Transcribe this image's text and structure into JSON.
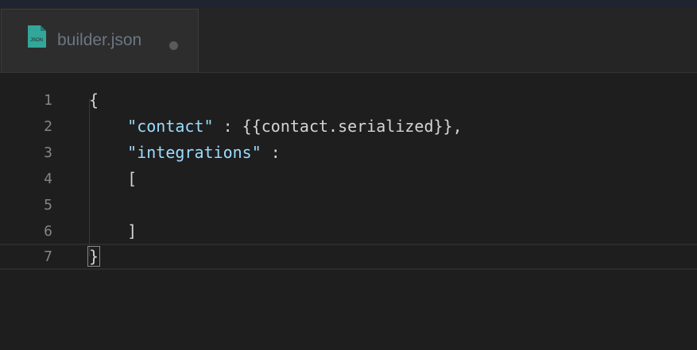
{
  "tab": {
    "title": "builder.json",
    "icon_name": "json-file-icon",
    "icon_text": "JSON",
    "icon_color": "#33a69a",
    "unsaved": true
  },
  "editor": {
    "lines": [
      {
        "num": "1",
        "indent": "",
        "key": "",
        "rest": "{"
      },
      {
        "num": "2",
        "indent": "    ",
        "key": "\"contact\"",
        "rest": " : {{contact.serialized}},"
      },
      {
        "num": "3",
        "indent": "    ",
        "key": "\"integrations\"",
        "rest": " :"
      },
      {
        "num": "4",
        "indent": "    ",
        "key": "",
        "rest": "["
      },
      {
        "num": "5",
        "indent": "",
        "key": "",
        "rest": ""
      },
      {
        "num": "6",
        "indent": "    ",
        "key": "",
        "rest": "]"
      },
      {
        "num": "7",
        "indent": "",
        "key": "",
        "rest": "}"
      }
    ],
    "current_line": 7
  },
  "colors": {
    "background": "#1e1e1e",
    "string_key": "#9cdcfe",
    "text": "#d4d4d4",
    "line_number": "#858585"
  }
}
